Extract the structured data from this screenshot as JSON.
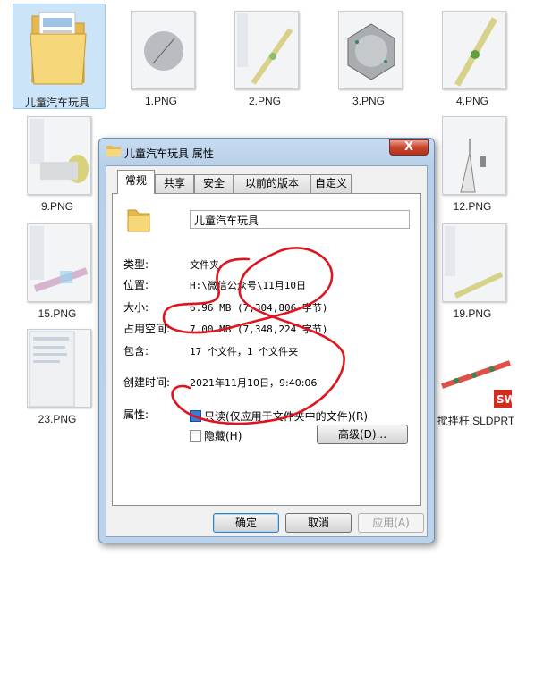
{
  "files": [
    {
      "name": "儿童汽车玩具",
      "kind": "folder",
      "selected": true
    },
    {
      "name": "1.PNG"
    },
    {
      "name": "2.PNG"
    },
    {
      "name": "3.PNG"
    },
    {
      "name": "4.PNG"
    },
    {
      "name": "9.PNG"
    },
    {
      "name": "12.PNG"
    },
    {
      "name": "15.PNG"
    },
    {
      "name": "19.PNG"
    },
    {
      "name": "23.PNG"
    },
    {
      "name": "搅拌杆.SLDPRT"
    }
  ],
  "dialog": {
    "title": "儿童汽车玩具 属性",
    "close_label": "X",
    "tabs": [
      "常规",
      "共享",
      "安全",
      "以前的版本",
      "自定义"
    ],
    "active_tab": "常规",
    "folder_name": "儿童汽车玩具",
    "rows": {
      "type_label": "类型:",
      "type_value": "文件夹",
      "location_label": "位置:",
      "location_value": "H:\\微信公众号\\11月10日",
      "size_label": "大小:",
      "size_value": "6.96 MB (7,304,806 字节)",
      "disk_label": "占用空间:",
      "disk_value": "7.00 MB (7,348,224 字节)",
      "contains_label": "包含:",
      "contains_value": "17 个文件，1 个文件夹",
      "created_label": "创建时间:",
      "created_value": "2021年11月10日，9:40:06",
      "attr_label": "属性:"
    },
    "readonly_label": "只读(仅应用于文件夹中的文件)(R)",
    "hidden_label": "隐藏(H)",
    "advanced_label": "高级(D)...",
    "ok_label": "确定",
    "cancel_label": "取消",
    "apply_label": "应用(A)"
  },
  "colors": {
    "annotation": "#e0141e",
    "accent_blue": "#3a7bd5",
    "sw_badge": "#d72b20"
  }
}
